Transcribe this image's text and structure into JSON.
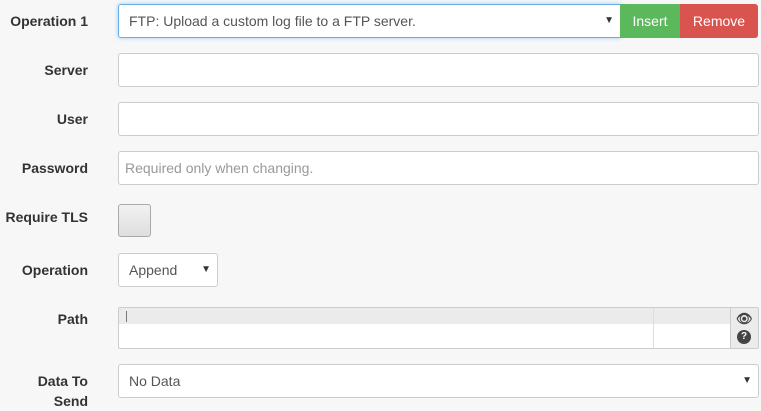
{
  "operation1": {
    "label": "Operation 1",
    "selected": "FTP: Upload a custom log file to a FTP server.",
    "insert_label": "Insert",
    "remove_label": "Remove"
  },
  "server": {
    "label": "Server",
    "value": ""
  },
  "user": {
    "label": "User",
    "value": ""
  },
  "password": {
    "label": "Password",
    "placeholder": "Required only when changing."
  },
  "require_tls": {
    "label": "Require TLS",
    "checked": false
  },
  "operation": {
    "label": "Operation",
    "selected": "Append"
  },
  "path": {
    "label": "Path",
    "value": ""
  },
  "data_to_send": {
    "label": "Data To Send",
    "selected": "No Data"
  },
  "colors": {
    "insert": "#5cb85c",
    "remove": "#d9534f",
    "focus_border": "#66afe9"
  },
  "icons": {
    "preview": "eye-icon",
    "help": "question-icon"
  }
}
